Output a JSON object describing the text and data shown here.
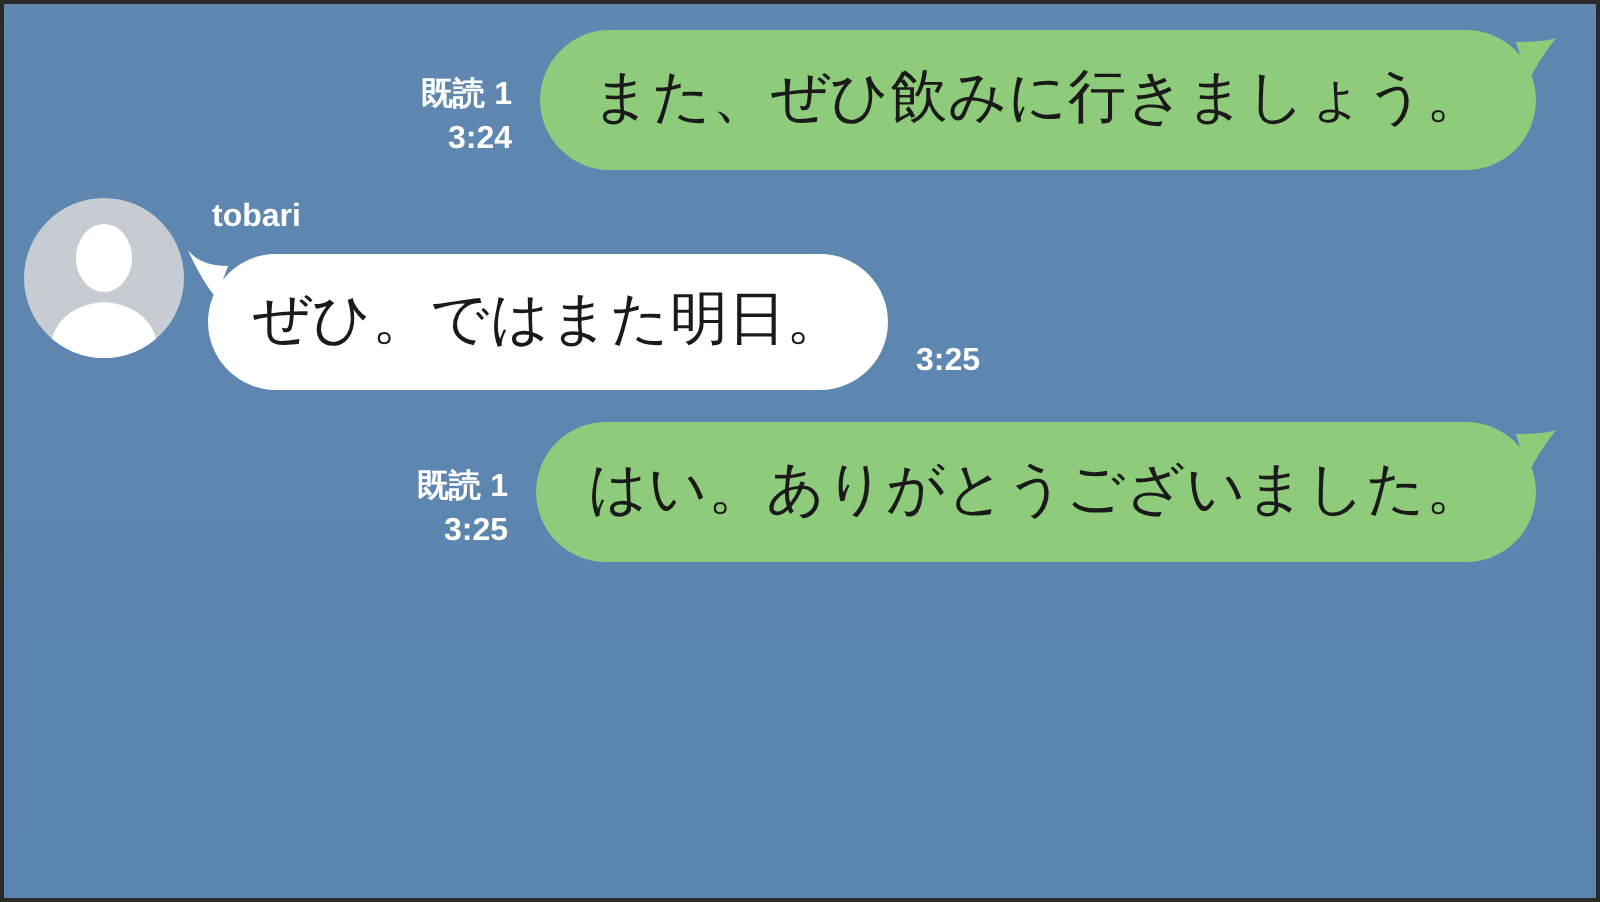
{
  "messages": [
    {
      "kind": "sent",
      "read_label": "既読 1",
      "time": "3:24",
      "text": "また、ぜひ飲みに行きましょう。"
    },
    {
      "kind": "received",
      "sender": "tobari",
      "time": "3:25",
      "text": "ぜひ。ではまた明日。"
    },
    {
      "kind": "sent",
      "read_label": "既読 1",
      "time": "3:25",
      "text": "はい。ありがとうございました。"
    }
  ]
}
